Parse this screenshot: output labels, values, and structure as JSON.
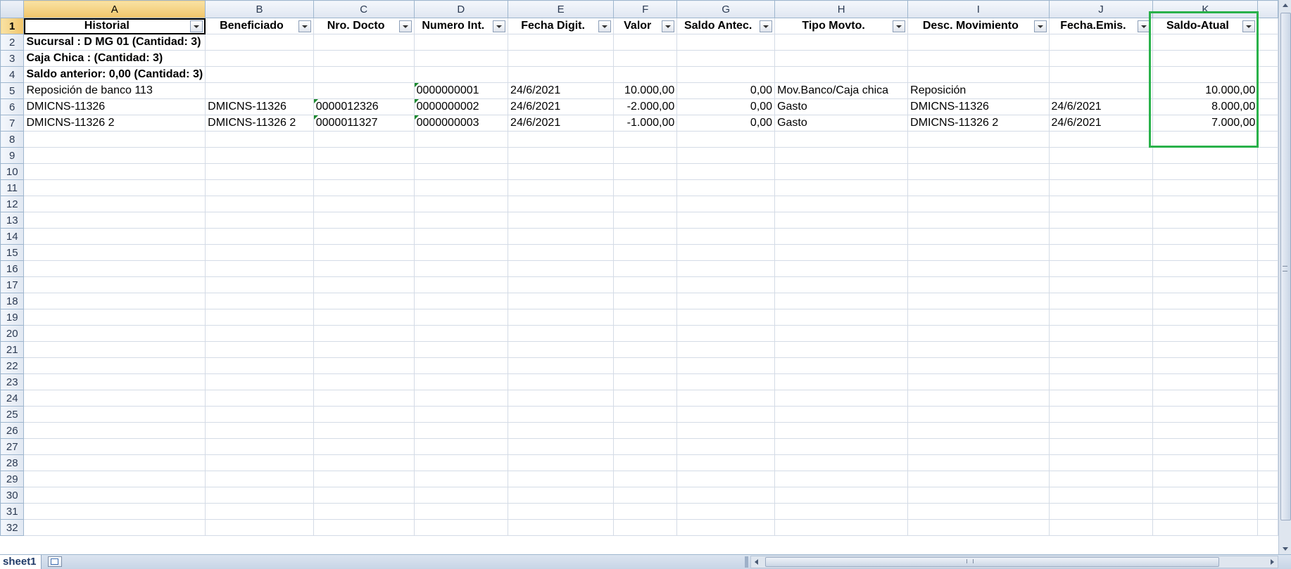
{
  "columns": [
    "A",
    "B",
    "C",
    "D",
    "E",
    "F",
    "G",
    "H",
    "I",
    "J",
    "K"
  ],
  "header_row": [
    "Historial",
    "Beneficiado",
    "Nro. Docto",
    "Numero Int.",
    "Fecha Digit.",
    "Valor",
    "Saldo Antec.",
    "Tipo Movto.",
    "Desc. Movimiento",
    "Fecha.Emis.",
    "Saldo-Atual"
  ],
  "summary_rows": [
    "Sucursal    : D MG 01 (Cantidad: 3)",
    "Caja Chica  :  (Cantidad: 3)",
    "Saldo anterior: 0,00 (Cantidad: 3)"
  ],
  "data_rows": [
    [
      "Reposición de banco 113",
      "",
      "",
      "0000000001",
      "24/6/2021",
      "10.000,00",
      "0,00",
      "Mov.Banco/Caja chica",
      "Reposición",
      "",
      "10.000,00"
    ],
    [
      "DMICNS-11326",
      "DMICNS-11326",
      "0000012326",
      "0000000002",
      "24/6/2021",
      "-2.000,00",
      "0,00",
      "Gasto",
      "DMICNS-11326",
      "24/6/2021",
      "8.000,00"
    ],
    [
      "DMICNS-11326 2",
      "DMICNS-11326 2",
      "0000011327",
      "0000000003",
      "24/6/2021",
      "-1.000,00",
      "0,00",
      "Gasto",
      "DMICNS-11326 2",
      "24/6/2021",
      "7.000,00"
    ]
  ],
  "total_visible_rows": 32,
  "sheet_tab": "sheet1",
  "highlight_color": "#29b14a"
}
